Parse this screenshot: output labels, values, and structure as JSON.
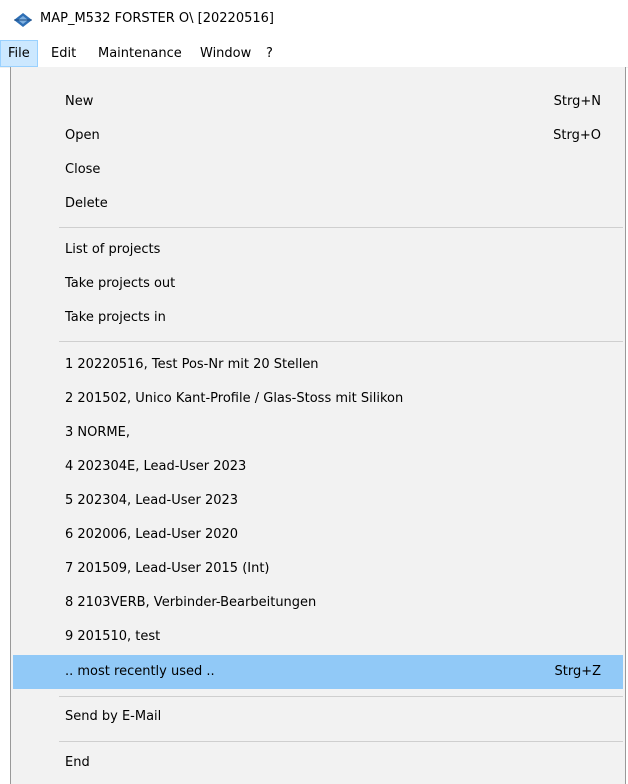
{
  "window": {
    "title": "MAP_M532 FORSTER O\\ [20220516]",
    "icon": "app-logo-icon"
  },
  "menubar": {
    "items": [
      {
        "label": "File",
        "active": true
      },
      {
        "label": "Edit"
      },
      {
        "label": "Maintenance"
      },
      {
        "label": "Window"
      },
      {
        "label": "?"
      }
    ]
  },
  "file_menu": {
    "items": [
      {
        "label": "New",
        "shortcut": "Strg+N"
      },
      {
        "label": "Open",
        "shortcut": "Strg+O"
      },
      {
        "label": "Close"
      },
      {
        "label": "Delete"
      },
      {
        "label": "List of projects"
      },
      {
        "label": "Take projects out"
      },
      {
        "label": "Take projects in"
      },
      {
        "label": "1 20220516, Test Pos-Nr mit 20 Stellen"
      },
      {
        "label": "2 201502, Unico Kant-Profile / Glas-Stoss mit Silikon"
      },
      {
        "label": "3 NORME,"
      },
      {
        "label": "4 202304E, Lead-User 2023"
      },
      {
        "label": "5 202304, Lead-User 2023"
      },
      {
        "label": "6 202006, Lead-User 2020"
      },
      {
        "label": "7 201509, Lead-User 2015 (Int)"
      },
      {
        "label": "8 2103VERB, Verbinder-Bearbeitungen"
      },
      {
        "label": "9 201510, test"
      },
      {
        "label": ".. most recently used ..",
        "shortcut": "Strg+Z",
        "highlighted": true
      },
      {
        "label": "Send by E-Mail"
      },
      {
        "label": "End"
      }
    ]
  },
  "colors": {
    "highlight": "#91c9f7",
    "menu_background": "#f2f2f2",
    "active_menu": "#cce8ff"
  }
}
